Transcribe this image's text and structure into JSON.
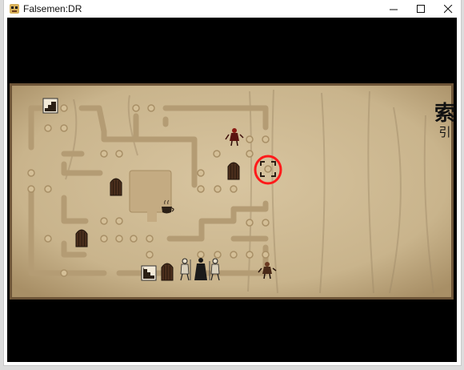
{
  "window": {
    "title": "Falsemen:DR",
    "controls": {
      "minimize": "minimize",
      "maximize": "maximize",
      "close": "close"
    }
  },
  "game": {
    "map_label_large": "索",
    "map_label_small": "引",
    "highlight_color": "#ff1a1a",
    "icons": [
      "stairs-icon",
      "door-icon",
      "coffee-cup-icon",
      "cursor-target-icon",
      "enemy-sprite",
      "party-member-sprite"
    ]
  }
}
